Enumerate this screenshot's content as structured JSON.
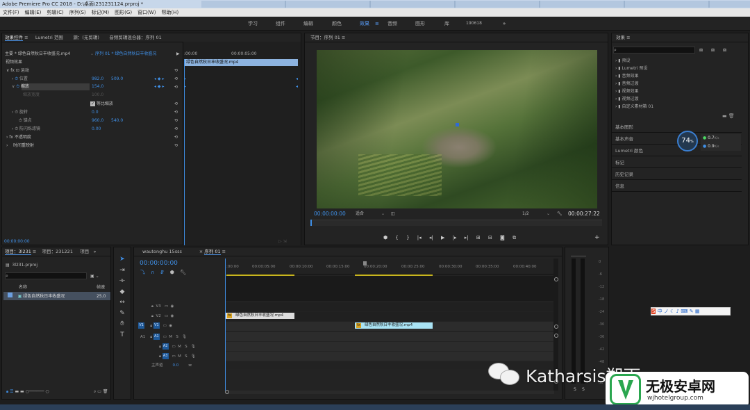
{
  "window": {
    "title": "Adobe Premiere Pro CC 2018 - D:\\桌面\\231231124.prproj *"
  },
  "menu": [
    "文件(F)",
    "编辑(E)",
    "剪辑(C)",
    "序列(S)",
    "标记(M)",
    "图形(G)",
    "窗口(W)",
    "帮助(H)"
  ],
  "workspaces": [
    "学习",
    "组件",
    "编辑",
    "颜色",
    "效果",
    "音频",
    "图形",
    "库",
    "190618"
  ],
  "workspace_active": "效果",
  "effect_controls": {
    "tabs": [
      "效果控件",
      "Lumetri 范围",
      "源：(无剪辑)",
      "音频剪辑混合器：序列 01"
    ],
    "master": "主要 * 绿色自然秋日丰收盛况.mp4",
    "seq": "序列 01 * 绿色自然秋日丰收盛况",
    "video_effects": "视频效果",
    "motion": "运动",
    "position_label": "位置",
    "position_x": "982.0",
    "position_y": "509.0",
    "scale_label": "缩放",
    "scale_value": "154.0",
    "scale_width_label": "缩放宽度",
    "scale_width_value": "100.0",
    "uniform_label": "等比缩放",
    "rotation_label": "旋转",
    "rotation_value": "0.0",
    "anchor_label": "锚点",
    "anchor_x": "960.0",
    "anchor_y": "540.0",
    "antiflicker_label": "防闪烁滤镜",
    "antiflicker_value": "0.00",
    "opacity_label": "不透明度",
    "timeremap_label": "时间重映射",
    "timecode": "00:00:00:00",
    "ruler_start": ":00:00",
    "ruler_mid": "00:00:05:00",
    "clip_label": "绿色自然秋日丰收盛况.mp4"
  },
  "program": {
    "title": "节目：序列 01",
    "timecode": "00:00:00:00",
    "fit": "适合",
    "res": "1/2",
    "duration": "00:00:27:22"
  },
  "project": {
    "tabs": [
      "项目：3l231",
      "项目：231221",
      "项目"
    ],
    "file": "3l231.prproj",
    "col_name": "名称",
    "col_rate": "帧速",
    "item": "绿色自然秋日丰收盛况",
    "item_rate": "25.0"
  },
  "timeline": {
    "tabs": [
      "wautonghu 15sss",
      "序列 01"
    ],
    "timecode": "00:00:00:00",
    "ruler": [
      ":00:00",
      "00:00:05:00",
      "00:00:10:00",
      "00:00:15:00",
      "00:00:20:00",
      "00:00:25:00",
      "00:00:30:00",
      "00:00:35:00",
      "00:00:40:00"
    ],
    "video_tracks": [
      "V3",
      "V2",
      "V1"
    ],
    "audio_tracks": [
      "A1",
      "A2",
      "A3"
    ],
    "src_v": "V1",
    "src_a": "A1",
    "master_label": "主声道",
    "master_value": "0.0",
    "m": "M",
    "s": "S",
    "clip_a": "绿色自然秋日丰收盛况.mp4",
    "clip_b": "绿色自然秋日丰收盛况.mp4"
  },
  "effects_panel": {
    "title": "效果",
    "folders": [
      "预设",
      "Lumetri 预设",
      "音频效果",
      "音频过渡",
      "视频效果",
      "视频过渡",
      "自定义素材箱 01"
    ],
    "sections": [
      "基本图形",
      "基本声音",
      "Lumetri 颜色",
      "标记",
      "历史记录",
      "信息"
    ]
  },
  "widget": {
    "percent": "74",
    "unit": "%",
    "up": "0.7",
    "down": "0.9",
    "rate": "K/s"
  },
  "meter_labels": [
    "0",
    "-6",
    "-12",
    "-18",
    "-24",
    "-30",
    "-36",
    "-42",
    "-48",
    "dB"
  ],
  "meter_solo": [
    "S",
    "S"
  ],
  "watermark": {
    "handle": "Katharsis朔下…",
    "brand": "无极安卓网",
    "url": "wjhotelgroup.com"
  }
}
